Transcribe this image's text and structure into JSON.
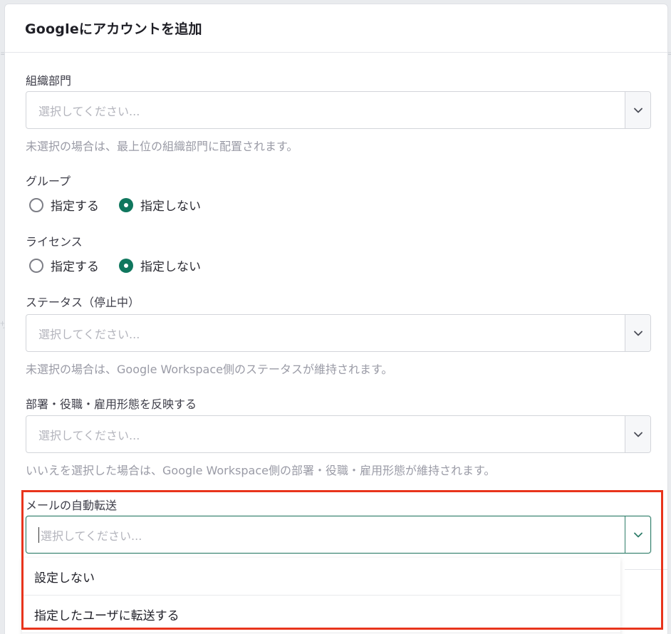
{
  "modal": {
    "title": "Googleにアカウントを追加"
  },
  "fields": {
    "org_unit": {
      "label": "組織部門",
      "placeholder": "選択してください...",
      "help": "未選択の場合は、最上位の組織部門に配置されます。"
    },
    "group": {
      "label": "グループ",
      "options": [
        "指定する",
        "指定しない"
      ],
      "selected": "指定しない"
    },
    "license": {
      "label": "ライセンス",
      "options": [
        "指定する",
        "指定しない"
      ],
      "selected": "指定しない"
    },
    "status": {
      "label": "ステータス（停止中）",
      "placeholder": "選択してください...",
      "help": "未選択の場合は、Google Workspace側のステータスが維持されます。"
    },
    "reflect": {
      "label": "部署・役職・雇用形態を反映する",
      "placeholder": "選択してください...",
      "help": "いいえを選択した場合は、Google Workspace側の部署・役職・雇用形態が維持されます。"
    },
    "mail_forward": {
      "label": "メールの自動転送",
      "placeholder": "選択してください...",
      "options": [
        "設定しない",
        "指定したユーザに転送する"
      ]
    }
  },
  "colors": {
    "accent": "#10775e",
    "highlight": "#e8341c"
  },
  "icons": {
    "select_toggle": "chevron-down-icon"
  }
}
